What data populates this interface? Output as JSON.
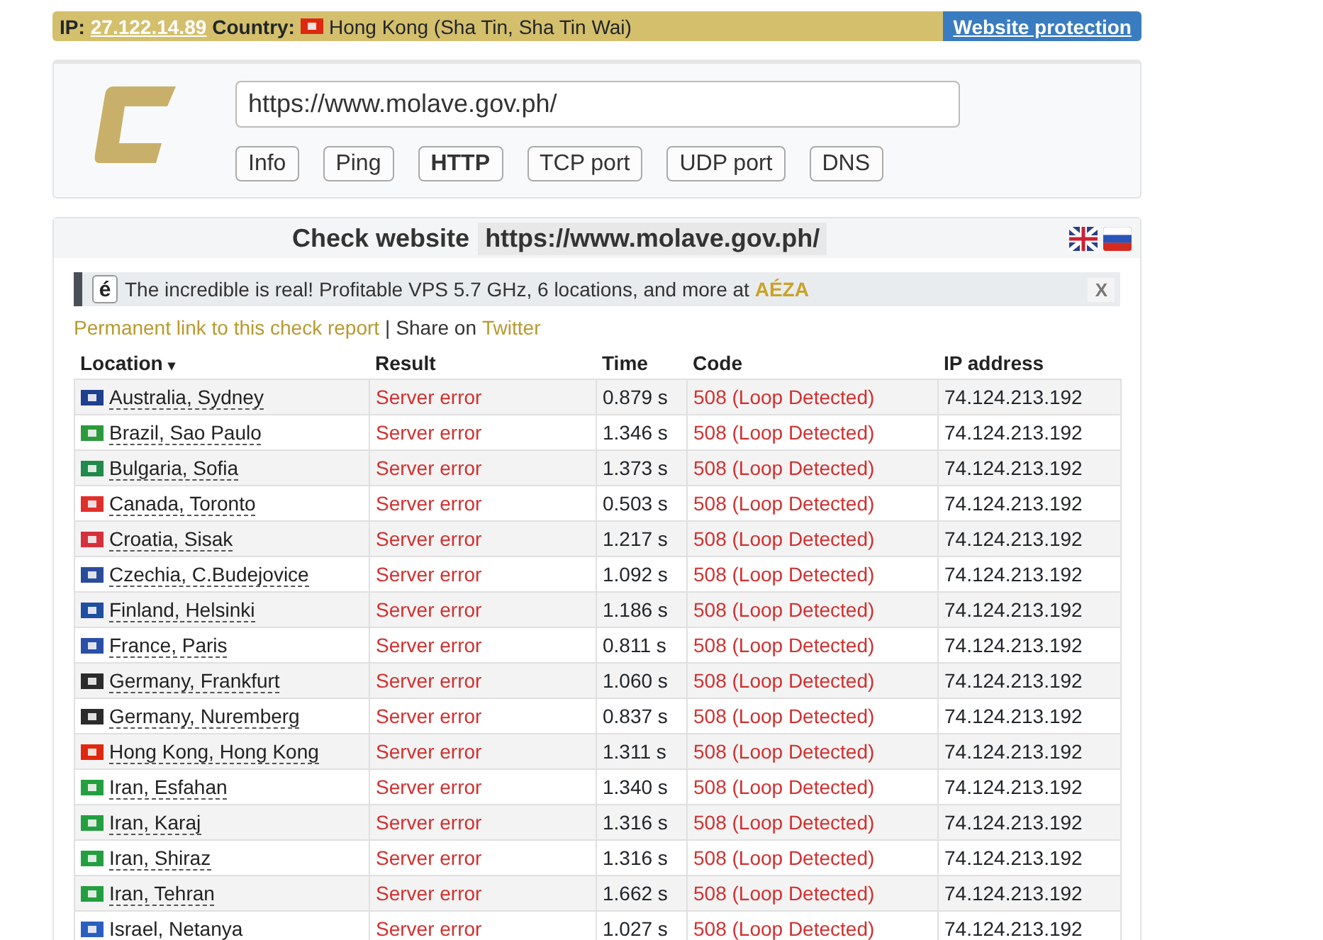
{
  "top_bar": {
    "ip_label": "IP:",
    "ip": "27.122.14.89",
    "country_label": "Country:",
    "country_flag": {
      "color": "#de2910"
    },
    "country": "Hong Kong (Sha Tin, Sha Tin Wai)",
    "protection_button": "Website protection"
  },
  "form": {
    "url_value": "https://www.molave.gov.ph/",
    "buttons": [
      {
        "label": "Info",
        "selected": false
      },
      {
        "label": "Ping",
        "selected": false
      },
      {
        "label": "HTTP",
        "selected": true
      },
      {
        "label": "TCP port",
        "selected": false
      },
      {
        "label": "UDP port",
        "selected": false
      },
      {
        "label": "DNS",
        "selected": false
      }
    ]
  },
  "results": {
    "title": "Check website",
    "url": "https://www.molave.gov.ph/",
    "ad": {
      "logo_letter": "é",
      "text": "The incredible is real! Profitable VPS 5.7 GHz, 6 locations, and more at ",
      "brand": "AÉZA",
      "close": "X"
    },
    "permalink": "Permanent link to this check report",
    "separator": "|",
    "share_label": "Share on",
    "share_link": "Twitter",
    "columns": [
      "Location",
      "Result",
      "Time",
      "Code",
      "IP address"
    ],
    "sort_indicator": "▾",
    "rows": [
      {
        "color": "#1f3f8f",
        "location": "Australia, Sydney",
        "result": "Server error",
        "time": "0.879 s",
        "code": "508 (Loop Detected)",
        "ip": "74.124.213.192"
      },
      {
        "color": "#2a9a3a",
        "location": "Brazil, Sao Paulo",
        "result": "Server error",
        "time": "1.346 s",
        "code": "508 (Loop Detected)",
        "ip": "74.124.213.192"
      },
      {
        "color": "#1f8a4a",
        "location": "Bulgaria, Sofia",
        "result": "Server error",
        "time": "1.373 s",
        "code": "508 (Loop Detected)",
        "ip": "74.124.213.192"
      },
      {
        "color": "#e0302a",
        "location": "Canada, Toronto",
        "result": "Server error",
        "time": "0.503 s",
        "code": "508 (Loop Detected)",
        "ip": "74.124.213.192"
      },
      {
        "color": "#d6303a",
        "location": "Croatia, Sisak",
        "result": "Server error",
        "time": "1.217 s",
        "code": "508 (Loop Detected)",
        "ip": "74.124.213.192"
      },
      {
        "color": "#2a4d9a",
        "location": "Czechia, C.Budejovice",
        "result": "Server error",
        "time": "1.092 s",
        "code": "508 (Loop Detected)",
        "ip": "74.124.213.192"
      },
      {
        "color": "#1f4fa0",
        "location": "Finland, Helsinki",
        "result": "Server error",
        "time": "1.186 s",
        "code": "508 (Loop Detected)",
        "ip": "74.124.213.192"
      },
      {
        "color": "#2a4fa8",
        "location": "France, Paris",
        "result": "Server error",
        "time": "0.811 s",
        "code": "508 (Loop Detected)",
        "ip": "74.124.213.192"
      },
      {
        "color": "#2b2b2b",
        "location": "Germany, Frankfurt",
        "result": "Server error",
        "time": "1.060 s",
        "code": "508 (Loop Detected)",
        "ip": "74.124.213.192"
      },
      {
        "color": "#2b2b2b",
        "location": "Germany, Nuremberg",
        "result": "Server error",
        "time": "0.837 s",
        "code": "508 (Loop Detected)",
        "ip": "74.124.213.192"
      },
      {
        "color": "#de2910",
        "location": "Hong Kong, Hong Kong",
        "result": "Server error",
        "time": "1.311 s",
        "code": "508 (Loop Detected)",
        "ip": "74.124.213.192"
      },
      {
        "color": "#239f40",
        "location": "Iran, Esfahan",
        "result": "Server error",
        "time": "1.340 s",
        "code": "508 (Loop Detected)",
        "ip": "74.124.213.192"
      },
      {
        "color": "#239f40",
        "location": "Iran, Karaj",
        "result": "Server error",
        "time": "1.316 s",
        "code": "508 (Loop Detected)",
        "ip": "74.124.213.192"
      },
      {
        "color": "#239f40",
        "location": "Iran, Shiraz",
        "result": "Server error",
        "time": "1.316 s",
        "code": "508 (Loop Detected)",
        "ip": "74.124.213.192"
      },
      {
        "color": "#239f40",
        "location": "Iran, Tehran",
        "result": "Server error",
        "time": "1.662 s",
        "code": "508 (Loop Detected)",
        "ip": "74.124.213.192"
      },
      {
        "color": "#2a5fc0",
        "location": "Israel, Netanya",
        "result": "Server error",
        "time": "1.027 s",
        "code": "508 (Loop Detected)",
        "ip": "74.124.213.192"
      }
    ]
  }
}
